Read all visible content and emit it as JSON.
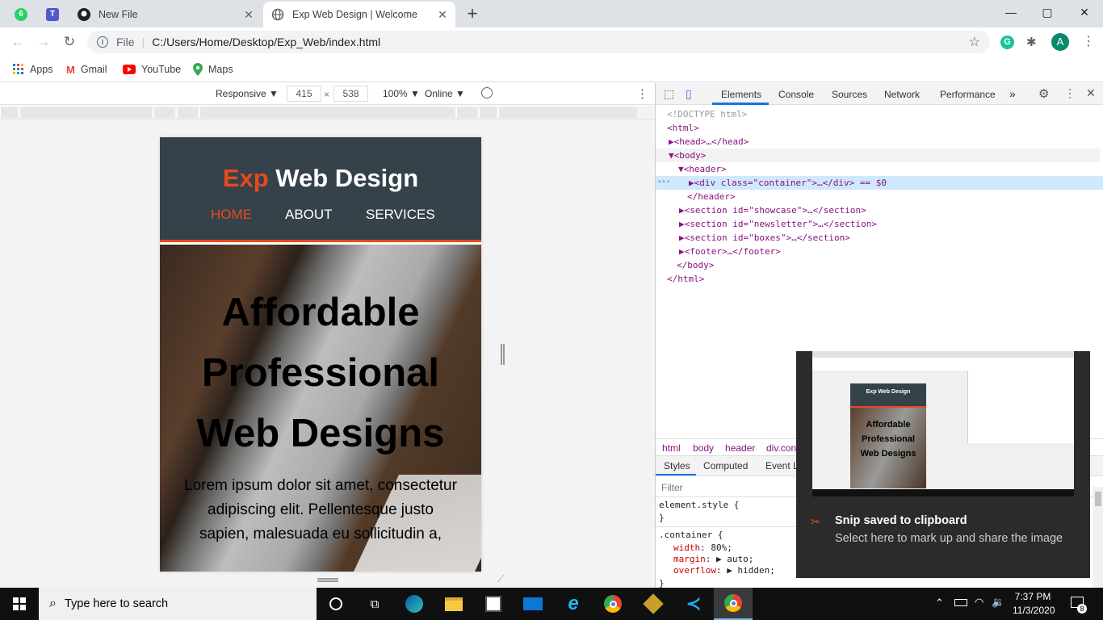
{
  "browser": {
    "pinned_tabs": [
      {
        "icon": "whatsapp-icon",
        "badge": "6"
      },
      {
        "icon": "teams-icon"
      }
    ],
    "tabs": [
      {
        "title": "New File",
        "icon": "github-icon",
        "active": false
      },
      {
        "title": "Exp Web Design | Welcome",
        "icon": "globe-icon",
        "active": true
      }
    ],
    "new_tab": "+",
    "window_controls": {
      "minimize": "—",
      "maximize": "▢",
      "close": "✕"
    },
    "address": {
      "scheme_label": "File",
      "url": "C:/Users/Home/Desktop/Exp_Web/index.html"
    },
    "profile_initial": "A",
    "bookmarks": [
      {
        "label": "Apps",
        "icon": "apps-grid-icon"
      },
      {
        "label": "Gmail",
        "icon": "gmail-icon"
      },
      {
        "label": "YouTube",
        "icon": "youtube-icon"
      },
      {
        "label": "Maps",
        "icon": "maps-icon"
      }
    ]
  },
  "device_toolbar": {
    "mode": "Responsive ▼",
    "width": "415",
    "times": "×",
    "height": "538",
    "zoom": "100% ▼",
    "network": "Online ▼"
  },
  "site": {
    "logo_highlight": "Exp",
    "logo_rest": " Web Design",
    "nav": [
      "HOME",
      "ABOUT",
      "SERVICES"
    ],
    "showcase_title": "Affordable Professional Web Designs",
    "showcase_text": "Lorem ipsum dolor sit amet, consectetur adipiscing elit. Pellentesque justo sapien, malesuada eu sollicitudin a,"
  },
  "devtools": {
    "tabs": [
      "Elements",
      "Console",
      "Sources",
      "Network",
      "Performance",
      "»"
    ],
    "dom": [
      "<!DOCTYPE html>",
      "<html>",
      "▶<head>…</head>",
      "▼<body>",
      "▼<header>",
      "▶<div class=\"container\">…</div> == $0",
      "</header>",
      "▶<section id=\"showcase\">…</section>",
      "▶<section id=\"newsletter\">…</section>",
      "▶<section id=\"boxes\">…</section>",
      "▶<footer>…</footer>",
      "</body>",
      "</html>"
    ],
    "ellipsis": "•••",
    "breadcrumbs": [
      "html",
      "body",
      "header",
      "div.con"
    ],
    "style_tabs": [
      "Styles",
      "Computed",
      "Event L"
    ],
    "filter_placeholder": "Filter",
    "element_style": "element.style {",
    "close_brace": "}",
    "rule_selector": ".container {",
    "rule_props": [
      {
        "name": "width",
        "value": "80%;"
      },
      {
        "name": "margin",
        "value": "▶ auto;"
      },
      {
        "name": "overflow",
        "value": "▶ hidden;"
      }
    ]
  },
  "toast": {
    "title": "Snip saved to clipboard",
    "body": "Select here to mark up and share the image",
    "thumb_title": "Exp Web Design",
    "thumb_text": "Affordable Professional Web Designs"
  },
  "taskbar": {
    "search_placeholder": "Type here to search",
    "time": "7:37 PM",
    "date": "11/3/2020",
    "notifications": "8"
  }
}
